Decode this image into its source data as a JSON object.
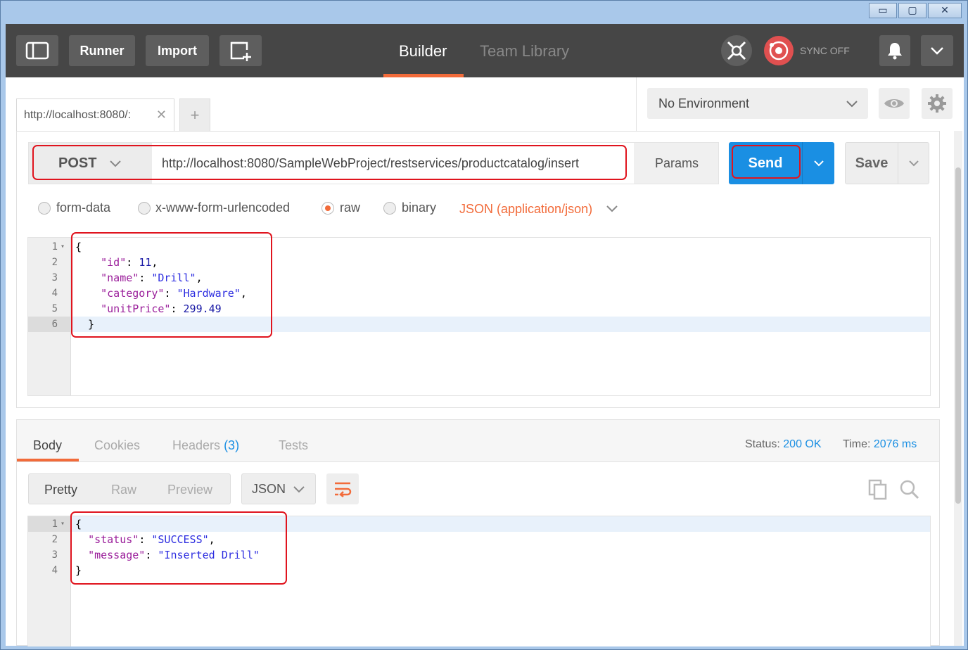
{
  "window": {
    "controls": [
      "▭",
      "▢",
      "✕"
    ]
  },
  "appbar": {
    "runner_label": "Runner",
    "import_label": "Import",
    "tabs": {
      "builder": "Builder",
      "team_library": "Team Library"
    },
    "sync_label": "SYNC OFF"
  },
  "request_tabs": {
    "active_tab": "http://localhost:8080/:",
    "add_label": "+"
  },
  "environment": {
    "selected": "No Environment"
  },
  "request": {
    "method": "POST",
    "url": "http://localhost:8080/SampleWebProject/restservices/productcatalog/insert",
    "params_label": "Params",
    "send_label": "Send",
    "save_label": "Save"
  },
  "body_types": {
    "options": [
      "form-data",
      "x-www-form-urlencoded",
      "raw",
      "binary"
    ],
    "selected": "raw",
    "content_type": "JSON (application/json)"
  },
  "request_body": {
    "line_numbers": [
      "1",
      "2",
      "3",
      "4",
      "5",
      "6"
    ],
    "lines": [
      "{",
      "    \"id\": 11,",
      "    \"name\": \"Drill\",",
      "    \"category\": \"Hardware\",",
      "    \"unitPrice\": 299.49",
      "  }"
    ]
  },
  "response": {
    "tabs": {
      "body": "Body",
      "cookies": "Cookies",
      "headers": "Headers",
      "headers_count": "(3)",
      "tests": "Tests"
    },
    "status_label": "Status:",
    "status_value": "200 OK",
    "time_label": "Time:",
    "time_value": "2076 ms",
    "formats": [
      "Pretty",
      "Raw",
      "Preview"
    ],
    "selected_format": "Pretty",
    "language": "JSON",
    "line_numbers": [
      "1",
      "2",
      "3",
      "4"
    ],
    "lines": [
      "{",
      "  \"status\": \"SUCCESS\",",
      "  \"message\": \"Inserted Drill\"",
      "}"
    ]
  },
  "colors": {
    "accent": "#f26b3a",
    "send": "#1a8fe3",
    "annotation": "#e0141e"
  },
  "icons": [
    "sidebar-toggle-icon",
    "new-window-icon",
    "interceptor-icon",
    "sync-icon",
    "bell-icon",
    "chevron-down-icon",
    "eye-icon",
    "gear-icon",
    "close-icon",
    "wrap-lines-icon",
    "copy-icon",
    "search-icon"
  ]
}
